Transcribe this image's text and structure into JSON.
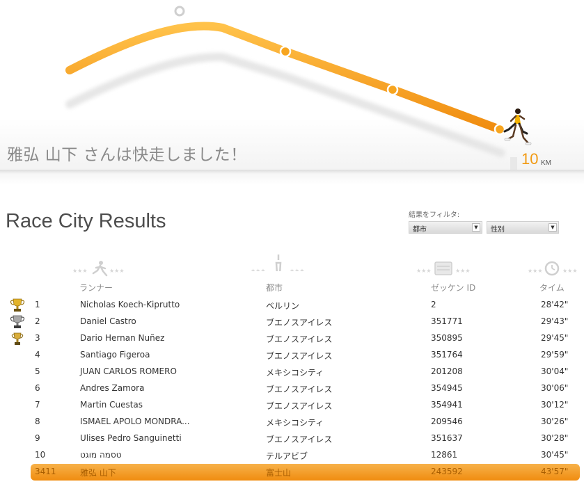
{
  "hero": {
    "message": "雅弘 山下 さんは快走しました！",
    "distance_value": "10",
    "distance_unit": "KM"
  },
  "results": {
    "title": "Race City Results",
    "filter_label": "結果をフィルタ:",
    "filters": [
      {
        "value": "都市"
      },
      {
        "value": "性別"
      }
    ],
    "columns": {
      "runner": "ランナー",
      "city": "都市",
      "bib": "ゼッケン ID",
      "time": "タイム"
    },
    "rows": [
      {
        "rank": "1",
        "name": "Nicholas Koech-Kiprutto",
        "city": "ベルリン",
        "bib": "2",
        "time": "28'42\"",
        "trophy": "gold"
      },
      {
        "rank": "2",
        "name": "Daniel Castro",
        "city": "ブエノスアイレス",
        "bib": "351771",
        "time": "29'43\"",
        "trophy": "silver"
      },
      {
        "rank": "3",
        "name": "Dario Hernan Nuñez",
        "city": "ブエノスアイレス",
        "bib": "350895",
        "time": "29'45\"",
        "trophy": "bronze"
      },
      {
        "rank": "4",
        "name": "Santiago Figeroa",
        "city": "ブエノスアイレス",
        "bib": "351764",
        "time": "29'59\"",
        "trophy": ""
      },
      {
        "rank": "5",
        "name": "JUAN CARLOS ROMERO",
        "city": "メキシコシティ",
        "bib": "201208",
        "time": "30'04\"",
        "trophy": ""
      },
      {
        "rank": "6",
        "name": "Andres Zamora",
        "city": "ブエノスアイレス",
        "bib": "354945",
        "time": "30'06\"",
        "trophy": ""
      },
      {
        "rank": "7",
        "name": "Martin Cuestas",
        "city": "ブエノスアイレス",
        "bib": "354941",
        "time": "30'12\"",
        "trophy": ""
      },
      {
        "rank": "8",
        "name": "ISMAEL  APOLO MONDRA...",
        "city": "メキシコシティ",
        "bib": "209546",
        "time": "30'26\"",
        "trophy": ""
      },
      {
        "rank": "9",
        "name": "Ulises Pedro Sanguinetti",
        "city": "ブエノスアイレス",
        "bib": "351637",
        "time": "30'28\"",
        "trophy": ""
      },
      {
        "rank": "10",
        "name": "טסמה מוגט",
        "city": "テルアビブ",
        "bib": "12861",
        "time": "30'45\"",
        "trophy": ""
      }
    ],
    "my_row": {
      "rank": "3411",
      "name": "雅弘 山下",
      "city": "富士山",
      "bib": "243592",
      "time": "43'57\""
    }
  },
  "colors": {
    "accent": "#f5a31a",
    "accent_dark": "#f08c0f",
    "gold": "#d9a520",
    "silver": "#8a8a8a",
    "bronze": "#c99a2e"
  },
  "icons": {
    "runner_column": "runner-icon",
    "city_column": "tower-icon",
    "bib_column": "bib-icon",
    "time_column": "stopwatch-icon",
    "trophy": "trophy-icon"
  }
}
